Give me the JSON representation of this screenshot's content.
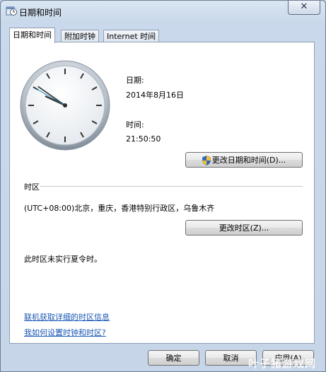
{
  "window": {
    "title": "日期和时间",
    "close_glyph": "✕"
  },
  "tabs": [
    {
      "label": "日期和时间",
      "active": true
    },
    {
      "label": "附加时钟",
      "active": false
    },
    {
      "label": "Internet 时间",
      "active": false
    }
  ],
  "datetime": {
    "date_label": "日期:",
    "date_value": "2014年8月16日",
    "time_label": "时间:",
    "time_value": "21:50:50",
    "change_datetime_button": "更改日期和时间(D)..."
  },
  "clock": {
    "hour": 21,
    "minute": 50,
    "second": 50
  },
  "timezone": {
    "section_label": "时区",
    "value": "(UTC+08:00)北京，重庆，香港特别行政区，乌鲁木齐",
    "change_timezone_button": "更改时区(Z)...",
    "dst_note": "此时区未实行夏令时。"
  },
  "links": {
    "online_info": "联机获取详细的时区信息",
    "how_to": "我如何设置时钟和时区?"
  },
  "footer": {
    "ok_button": "确定",
    "cancel_button": "取消",
    "apply_button": "应用(A)"
  },
  "watermark": "叶子猪游戏网",
  "colors": {
    "link": "#1a57b5",
    "titlebar": "#c9d8ea"
  }
}
